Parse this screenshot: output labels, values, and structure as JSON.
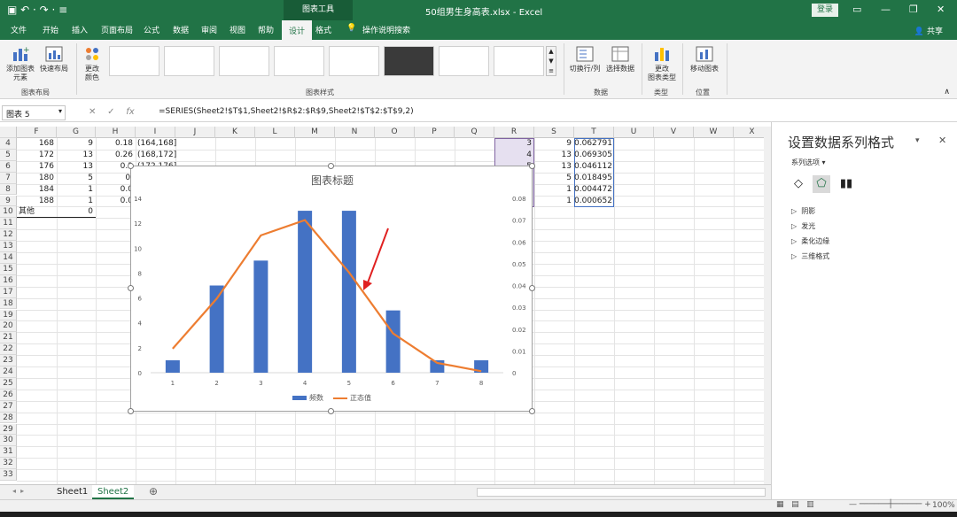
{
  "titlebar": {
    "qa_icons": "▣  ↶ ·  ↷ ·  ≡",
    "tool": "图表工具",
    "filename": "50组男生身高表.xlsx  -  Excel",
    "login": "登录"
  },
  "tabs": [
    "文件",
    "开始",
    "插入",
    "页面布局",
    "公式",
    "数据",
    "审阅",
    "视图",
    "帮助",
    "设计",
    "格式"
  ],
  "tell_me": "操作说明搜索",
  "share": "共享",
  "ribbon": {
    "add_element": "添加图表\n元素",
    "quick_layout": "快速布局",
    "change_color": "更改\n颜色",
    "layout_group": "图表布局",
    "styles_group": "图表样式",
    "switch_row_col": "切换行/列",
    "select_data": "选择数据",
    "data_group": "数据",
    "change_type": "更改\n图表类型",
    "type_group": "类型",
    "move_chart": "移动图表",
    "location_group": "位置"
  },
  "namebox": "图表 5",
  "formula": "=SERIES(Sheet2!$T$1,Sheet2!$R$2:$R$9,Sheet2!$T$2:$T$9,2)",
  "columns": [
    "F",
    "G",
    "H",
    "I",
    "J",
    "K",
    "L",
    "M",
    "N",
    "O",
    "P",
    "Q",
    "R",
    "S",
    "T",
    "U",
    "V",
    "W",
    "X"
  ],
  "rows": [
    "4",
    "5",
    "6",
    "7",
    "8",
    "9",
    "10",
    "11",
    "12",
    "13",
    "14",
    "15",
    "16",
    "17",
    "18",
    "19",
    "20",
    "21",
    "22",
    "23",
    "24",
    "25",
    "26",
    "27",
    "28",
    "29",
    "30",
    "31",
    "32",
    "33"
  ],
  "cells": {
    "F": [
      "168",
      "172",
      "176",
      "180",
      "184",
      "188",
      "其他"
    ],
    "G": [
      "9",
      "13",
      "13",
      "5",
      "1",
      "1",
      "0"
    ],
    "H": [
      "0.18",
      "0.26",
      "0.2",
      "0.",
      "0.0",
      "0.0"
    ],
    "I": [
      "(164,168]",
      "(168,172]",
      "(172,176]"
    ],
    "R": [
      "3",
      "4",
      "5",
      "6",
      "7",
      "8"
    ],
    "S": [
      "9",
      "13",
      "13",
      "5",
      "1",
      "1"
    ],
    "T": [
      "0.062791",
      "0.069305",
      "0.046112",
      "0.018495",
      "0.004472",
      "0.000652"
    ]
  },
  "chart_data": {
    "type": "bar",
    "title": "图表标题",
    "categories": [
      "1",
      "2",
      "3",
      "4",
      "5",
      "6",
      "7",
      "8"
    ],
    "series": [
      {
        "name": "频数",
        "type": "bar",
        "color": "#4472c4",
        "values": [
          1,
          7,
          9,
          13,
          13,
          5,
          1,
          1
        ]
      },
      {
        "name": "正态值",
        "type": "line",
        "axis": "secondary",
        "color": "#ed7d31",
        "values": [
          0.011,
          0.034,
          0.063,
          0.07,
          0.046,
          0.018,
          0.0045,
          0.0007
        ]
      }
    ],
    "y_ticks": [
      "0",
      "2",
      "4",
      "6",
      "8",
      "10",
      "12",
      "14"
    ],
    "y2_ticks": [
      "0",
      "0.01",
      "0.02",
      "0.03",
      "0.04",
      "0.05",
      "0.06",
      "0.07",
      "0.08"
    ],
    "ylim": [
      0,
      14
    ],
    "y2lim": [
      0,
      0.08
    ],
    "legend": "bottom"
  },
  "sheets": [
    "Sheet1",
    "Sheet2"
  ],
  "pane": {
    "title": "设置数据系列格式",
    "options_label": "系列选项",
    "sections": [
      "阴影",
      "发光",
      "柔化边缘",
      "三维格式"
    ]
  },
  "status": {
    "zoom": "100%"
  }
}
